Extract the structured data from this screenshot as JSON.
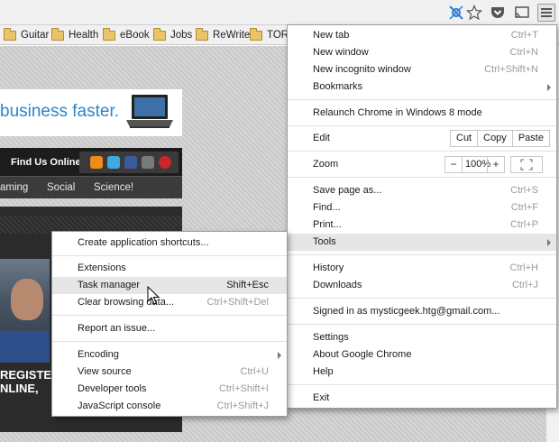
{
  "toolbar": {
    "icons": [
      "extension-icon",
      "star-icon",
      "pocket-icon",
      "cast-icon",
      "menu-icon"
    ]
  },
  "bookmarks": [
    {
      "label": "Guitar"
    },
    {
      "label": "Health"
    },
    {
      "label": "eBook"
    },
    {
      "label": "Jobs"
    },
    {
      "label": "ReWrite"
    },
    {
      "label": "TOR"
    }
  ],
  "page": {
    "banner_text": "business faster.",
    "find_us": "Find Us Online:",
    "nav": [
      "aming",
      "Social",
      "Science!"
    ],
    "register_line1": "REGISTER",
    "register_line2": "NLINE,"
  },
  "chrome_menu": {
    "new_tab": {
      "label": "New tab",
      "shortcut": "Ctrl+T"
    },
    "new_window": {
      "label": "New window",
      "shortcut": "Ctrl+N"
    },
    "new_incognito": {
      "label": "New incognito window",
      "shortcut": "Ctrl+Shift+N"
    },
    "bookmarks": {
      "label": "Bookmarks"
    },
    "relaunch": {
      "label": "Relaunch Chrome in Windows 8 mode"
    },
    "edit": {
      "label": "Edit",
      "cut": "Cut",
      "copy": "Copy",
      "paste": "Paste"
    },
    "zoom": {
      "label": "Zoom",
      "minus": "−",
      "value": "100%",
      "plus": "+"
    },
    "save_page": {
      "label": "Save page as...",
      "shortcut": "Ctrl+S"
    },
    "find": {
      "label": "Find...",
      "shortcut": "Ctrl+F"
    },
    "print": {
      "label": "Print...",
      "shortcut": "Ctrl+P"
    },
    "tools": {
      "label": "Tools"
    },
    "history": {
      "label": "History",
      "shortcut": "Ctrl+H"
    },
    "downloads": {
      "label": "Downloads",
      "shortcut": "Ctrl+J"
    },
    "signed_in": {
      "label": "Signed in as mysticgeek.htg@gmail.com..."
    },
    "settings": {
      "label": "Settings"
    },
    "about": {
      "label": "About Google Chrome"
    },
    "help": {
      "label": "Help"
    },
    "exit": {
      "label": "Exit"
    }
  },
  "tools_menu": {
    "create_shortcuts": {
      "label": "Create application shortcuts..."
    },
    "extensions": {
      "label": "Extensions"
    },
    "task_manager": {
      "label": "Task manager",
      "shortcut": "Shift+Esc"
    },
    "clear_browsing": {
      "label": "Clear browsing data...",
      "shortcut": "Ctrl+Shift+Del"
    },
    "report_issue": {
      "label": "Report an issue..."
    },
    "encoding": {
      "label": "Encoding"
    },
    "view_source": {
      "label": "View source",
      "shortcut": "Ctrl+U"
    },
    "developer_tools": {
      "label": "Developer tools",
      "shortcut": "Ctrl+Shift+I"
    },
    "js_console": {
      "label": "JavaScript console",
      "shortcut": "Ctrl+Shift+J"
    }
  },
  "colors": {
    "banner_text": "#2a86c9",
    "highlight": "#e6e6e6",
    "shortcut_gray": "#9a9a9a"
  }
}
